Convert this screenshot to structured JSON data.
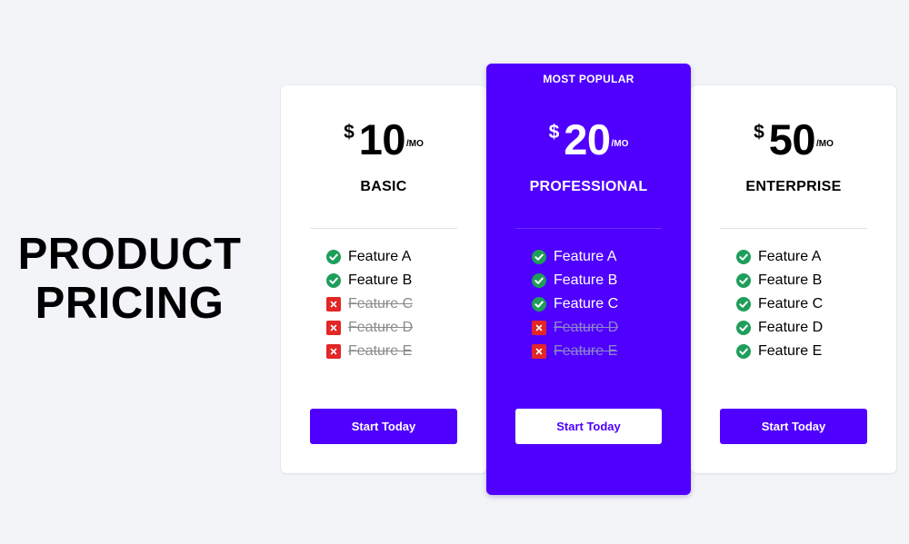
{
  "page": {
    "title_line1": "PRODUCT",
    "title_line2": "PRICING"
  },
  "colors": {
    "accent": "#4f00ff",
    "background": "#f3f4f8",
    "check": "#1e9e5a",
    "cross": "#e32626"
  },
  "plans": [
    {
      "name": "BASIC",
      "currency": "$",
      "amount": "10",
      "period": "/MO",
      "badge": "",
      "cta": "Start Today",
      "features": [
        {
          "label": "Feature A",
          "included": true,
          "icon": "check-icon"
        },
        {
          "label": "Feature B",
          "included": true,
          "icon": "check-icon"
        },
        {
          "label": "Feature C",
          "included": false,
          "icon": "cross-icon"
        },
        {
          "label": "Feature D",
          "included": false,
          "icon": "cross-icon"
        },
        {
          "label": "Feature E",
          "included": false,
          "icon": "cross-icon"
        }
      ]
    },
    {
      "name": "PROFESSIONAL",
      "currency": "$",
      "amount": "20",
      "period": "/MO",
      "badge": "MOST POPULAR",
      "cta": "Start Today",
      "features": [
        {
          "label": "Feature A",
          "included": true,
          "icon": "check-icon"
        },
        {
          "label": "Feature B",
          "included": true,
          "icon": "check-icon"
        },
        {
          "label": "Feature C",
          "included": true,
          "icon": "check-icon"
        },
        {
          "label": "Feature D",
          "included": false,
          "icon": "cross-icon"
        },
        {
          "label": "Feature E",
          "included": false,
          "icon": "cross-icon"
        }
      ]
    },
    {
      "name": "ENTERPRISE",
      "currency": "$",
      "amount": "50",
      "period": "/MO",
      "badge": "",
      "cta": "Start Today",
      "features": [
        {
          "label": "Feature A",
          "included": true,
          "icon": "check-icon"
        },
        {
          "label": "Feature B",
          "included": true,
          "icon": "check-icon"
        },
        {
          "label": "Feature C",
          "included": true,
          "icon": "check-icon"
        },
        {
          "label": "Feature D",
          "included": true,
          "icon": "check-icon"
        },
        {
          "label": "Feature E",
          "included": true,
          "icon": "check-icon"
        }
      ]
    }
  ]
}
